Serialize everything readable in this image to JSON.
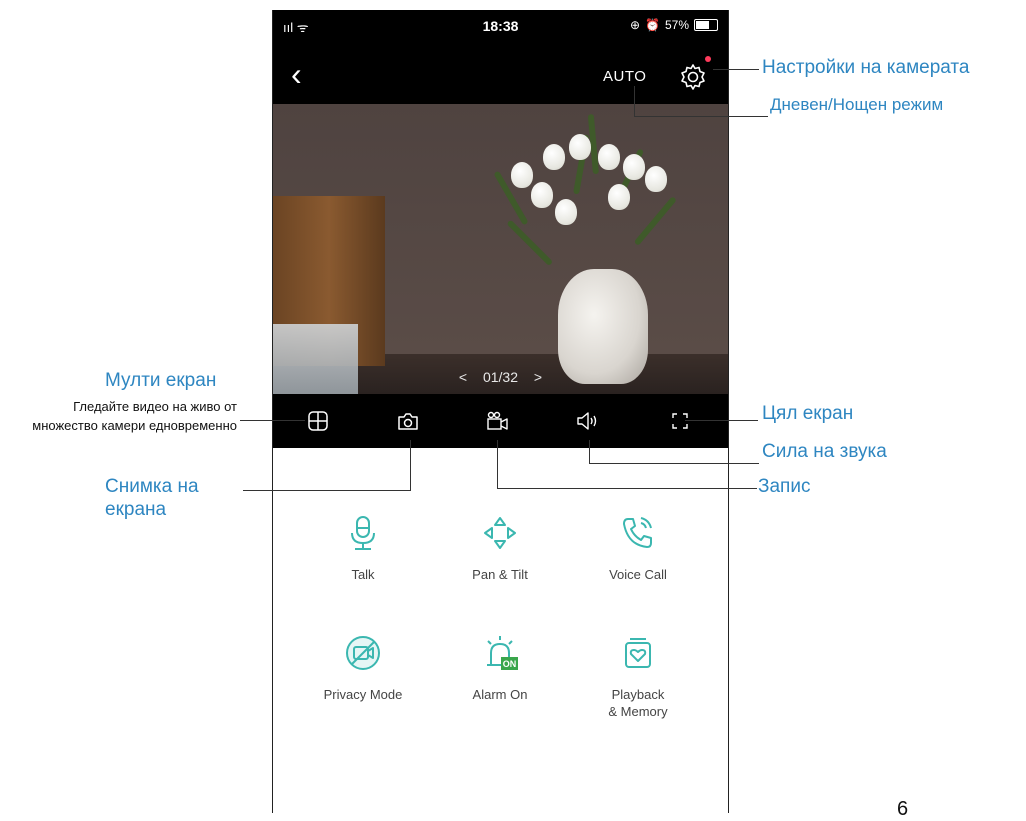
{
  "status_bar": {
    "time": "18:38",
    "signal": "ııl ᯤ",
    "battery": "57%"
  },
  "nav": {
    "back": "‹",
    "mode": "AUTO"
  },
  "video": {
    "pager_prev": "<",
    "pager_text": "01/32",
    "pager_next": ">"
  },
  "features": [
    {
      "label": "Talk",
      "icon": "microphone-icon"
    },
    {
      "label": "Pan & Tilt",
      "icon": "pan-tilt-icon"
    },
    {
      "label": "Voice Call",
      "icon": "voice-call-icon"
    },
    {
      "label": "Privacy Mode",
      "icon": "privacy-mode-icon"
    },
    {
      "label": "Alarm On",
      "icon": "alarm-icon",
      "badge": "ON"
    },
    {
      "label": "Playback\n& Memory",
      "icon": "playback-icon"
    }
  ],
  "annotations": {
    "camera_settings": "Настройки на камерата",
    "day_night": "Дневен/Нощен режим",
    "multi_screen": "Мулти екран",
    "multi_screen_desc": "Гледайте видео на живо от множество камери едновременно",
    "full_screen": "Цял екран",
    "volume": "Сила на звука",
    "snapshot": "Снимка на екрана",
    "record": "Запис"
  },
  "page_number": "6",
  "colors": {
    "accent": "#3bb7b0",
    "annotation": "#2e86c1",
    "badge": "#3aa64c",
    "dot": "#ff3b5c"
  }
}
